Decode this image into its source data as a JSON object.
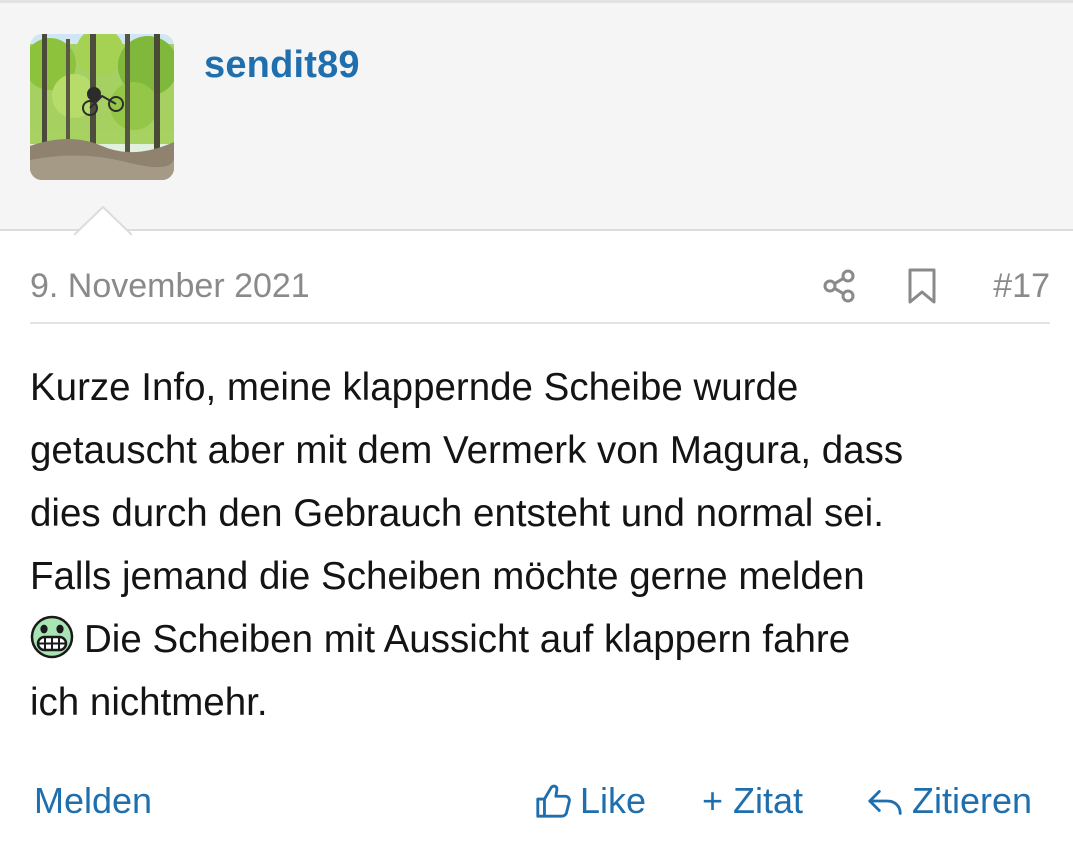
{
  "user": {
    "name": "sendit89",
    "avatar_icon": "avatar-photo-mountainbike"
  },
  "post": {
    "date": "9. November 2021",
    "number": "#17",
    "body_lines": [
      "Kurze Info, meine klappernde Scheibe wurde",
      "getauscht aber mit dem Vermerk von Magura, dass",
      "dies durch den Gebrauch entsteht und normal sei.",
      "Falls jemand die Scheiben möchte gerne melden",
      "Die Scheiben mit Aussicht auf klappern fahre",
      "ich nichtmehr."
    ],
    "emoji_icon": "grimacing-face-icon"
  },
  "actions": {
    "report": "Melden",
    "like": "Like",
    "quote": "+ Zitat",
    "reply": "Zitieren"
  },
  "colors": {
    "link": "#1f6fae",
    "meta_text": "#8a8a8a",
    "user_bar_bg": "#f5f5f5",
    "body_text": "#141414"
  }
}
